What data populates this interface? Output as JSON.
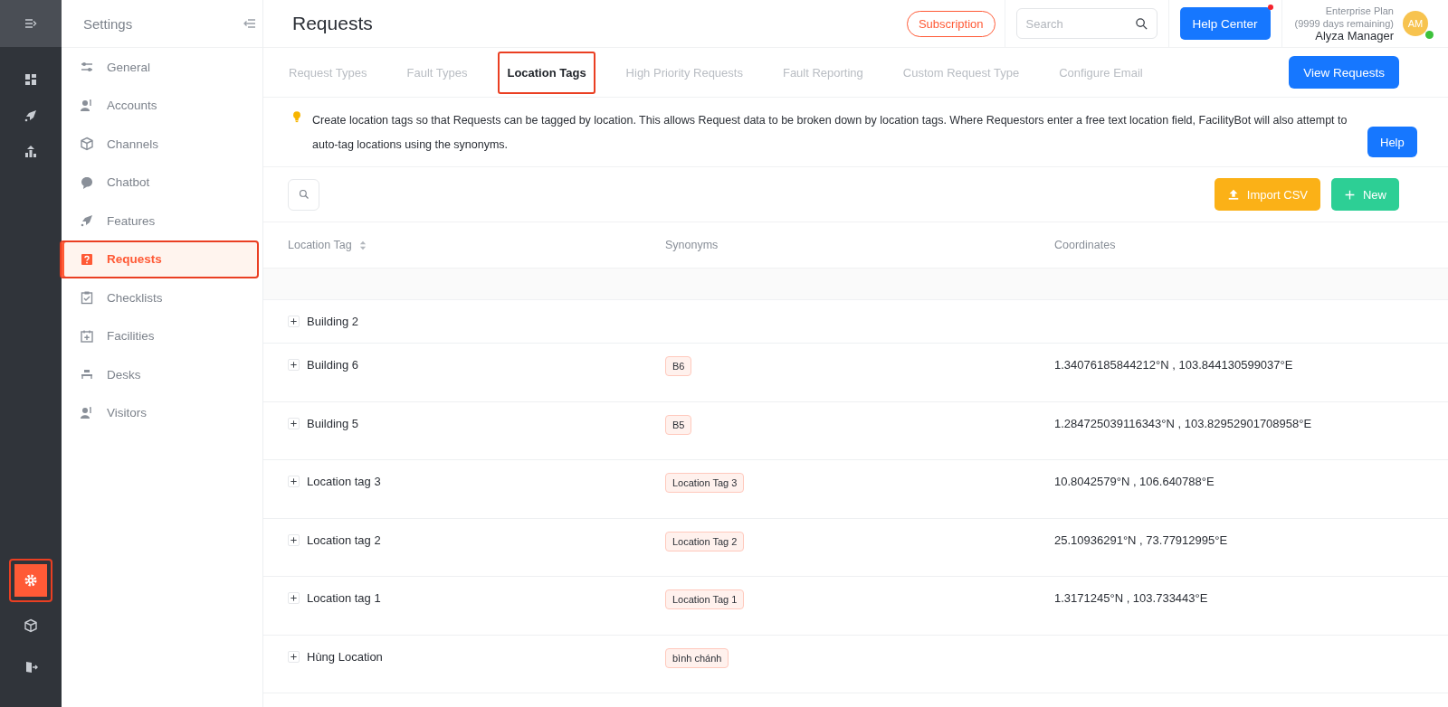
{
  "rail": {
    "items": [
      {
        "kind": "dashboard",
        "selected": false
      },
      {
        "kind": "rocket",
        "selected": false
      },
      {
        "kind": "chart",
        "selected": false
      }
    ],
    "bottom_items": [
      {
        "kind": "settings",
        "selected": true,
        "highlighted": true
      },
      {
        "kind": "cube",
        "selected": false,
        "highlighted": false
      },
      {
        "kind": "exit",
        "selected": false,
        "highlighted": false
      }
    ]
  },
  "sidebar": {
    "title": "Settings",
    "items": [
      {
        "label": "General",
        "kind": "sliders",
        "selected": false,
        "highlighted": false
      },
      {
        "label": "Accounts",
        "kind": "people",
        "selected": false,
        "highlighted": false
      },
      {
        "label": "Channels",
        "kind": "cube",
        "selected": false,
        "highlighted": false
      },
      {
        "label": "Chatbot",
        "kind": "chat",
        "selected": false,
        "highlighted": false
      },
      {
        "label": "Features",
        "kind": "rocket",
        "selected": false,
        "highlighted": false
      },
      {
        "label": "Requests",
        "kind": "question",
        "selected": true,
        "highlighted": true
      },
      {
        "label": "Checklists",
        "kind": "clipboard",
        "selected": false,
        "highlighted": false
      },
      {
        "label": "Facilities",
        "kind": "calendar",
        "selected": false,
        "highlighted": false
      },
      {
        "label": "Desks",
        "kind": "desk",
        "selected": false,
        "highlighted": false
      },
      {
        "label": "Visitors",
        "kind": "people",
        "selected": false,
        "highlighted": false
      }
    ]
  },
  "header": {
    "title": "Requests",
    "subscription": "Subscription",
    "search": {
      "placeholder": "Search"
    },
    "help_center": "Help Center",
    "plan": "Enterprise Plan",
    "days_remaining": "(9999 days remaining)",
    "user_name": "Alyza Manager",
    "avatar": "AM"
  },
  "tabs": [
    {
      "label": "Request Types",
      "selected": false,
      "highlighted": false
    },
    {
      "label": "Fault Types",
      "selected": false,
      "highlighted": false
    },
    {
      "label": "Location Tags",
      "selected": true,
      "highlighted": true
    },
    {
      "label": "High Priority Requests",
      "selected": false,
      "highlighted": false
    },
    {
      "label": "Fault Reporting",
      "selected": false,
      "highlighted": false
    },
    {
      "label": "Custom Request Type",
      "selected": false,
      "highlighted": false
    },
    {
      "label": "Configure Email",
      "selected": false,
      "highlighted": false
    }
  ],
  "view_requests": "View Requests",
  "info": {
    "text": "Create location tags so that Requests can be tagged by location. This allows Request data to be broken down by location tags. Where Requestors enter a free text location field, FacilityBot will also attempt to auto-tag locations using the synonyms.",
    "help": "Help"
  },
  "toolbar": {
    "import": "Import CSV",
    "new": "New"
  },
  "table": {
    "columns": [
      "Location Tag",
      "Synonyms",
      "Coordinates"
    ],
    "rows": [
      {
        "name": "Building 2",
        "synonyms": [],
        "coordinates": ""
      },
      {
        "name": "Building 6",
        "synonyms": [
          "B6"
        ],
        "coordinates": "1.34076185844212°N , 103.844130599037°E"
      },
      {
        "name": "Building 5",
        "synonyms": [
          "B5"
        ],
        "coordinates": "1.284725039116343°N , 103.82952901708958°E"
      },
      {
        "name": "Location tag 3",
        "synonyms": [
          "Location Tag 3"
        ],
        "coordinates": "10.8042579°N , 106.640788°E"
      },
      {
        "name": "Location tag 2",
        "synonyms": [
          "Location Tag 2"
        ],
        "coordinates": "25.10936291°N , 73.77912995°E"
      },
      {
        "name": "Location tag 1",
        "synonyms": [
          "Location Tag 1"
        ],
        "coordinates": "1.3171245°N , 103.733443°E"
      },
      {
        "name": "Hùng Location",
        "synonyms": [
          "bình chánh"
        ],
        "coordinates": ""
      }
    ]
  }
}
